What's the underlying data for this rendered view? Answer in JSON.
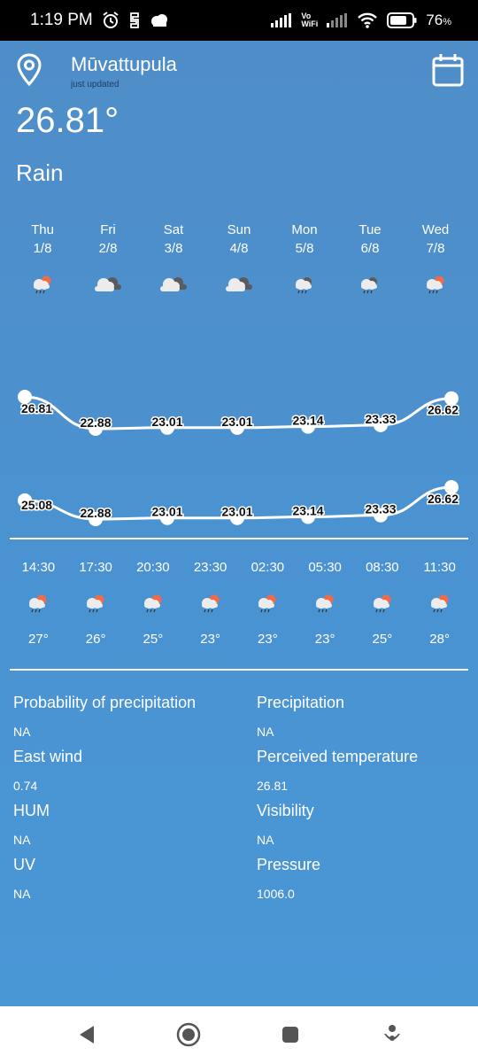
{
  "status": {
    "time": "1:19 PM",
    "battery": "76",
    "wifi_label_top": "Vo",
    "wifi_label_bottom": "WiFi"
  },
  "header": {
    "city": "Mūvattupula",
    "updated": "just updated",
    "temperature": "26.81°",
    "condition": "Rain"
  },
  "days": [
    {
      "name": "Thu",
      "date": "1/8",
      "icon": "rain-icon"
    },
    {
      "name": "Fri",
      "date": "2/8",
      "icon": "cloudy-icon"
    },
    {
      "name": "Sat",
      "date": "3/8",
      "icon": "cloudy-icon"
    },
    {
      "name": "Sun",
      "date": "4/8",
      "icon": "cloudy-icon"
    },
    {
      "name": "Mon",
      "date": "5/8",
      "icon": "cloud-rain-icon"
    },
    {
      "name": "Tue",
      "date": "6/8",
      "icon": "cloud-rain-icon"
    },
    {
      "name": "Wed",
      "date": "7/8",
      "icon": "rain-icon"
    }
  ],
  "chart_data": {
    "type": "line",
    "categories": [
      "Thu",
      "Fri",
      "Sat",
      "Sun",
      "Mon",
      "Tue",
      "Wed"
    ],
    "series": [
      {
        "values": [
          26.81,
          22.88,
          23.01,
          23.01,
          23.14,
          23.33,
          26.62
        ]
      },
      {
        "values": [
          25.08,
          22.88,
          23.01,
          23.01,
          23.14,
          23.33,
          26.62
        ]
      }
    ]
  },
  "hours": [
    {
      "time": "14:30",
      "temp": "27°"
    },
    {
      "time": "17:30",
      "temp": "26°"
    },
    {
      "time": "20:30",
      "temp": "25°"
    },
    {
      "time": "23:30",
      "temp": "23°"
    },
    {
      "time": "02:30",
      "temp": "23°"
    },
    {
      "time": "05:30",
      "temp": "23°"
    },
    {
      "time": "08:30",
      "temp": "25°"
    },
    {
      "time": "11:30",
      "temp": "28°"
    }
  ],
  "details": {
    "rows": [
      {
        "left_label": "Probability of precipitation",
        "left_value": "NA",
        "right_label": "Precipitation",
        "right_value": "NA"
      },
      {
        "left_label": "East wind",
        "left_value": "0.74",
        "right_label": "Perceived temperature",
        "right_value": "26.81"
      },
      {
        "left_label": "HUM",
        "left_value": "NA",
        "right_label": "Visibility",
        "right_value": "NA"
      },
      {
        "left_label": "UV",
        "left_value": "NA",
        "right_label": "Pressure",
        "right_value": "1006.0"
      }
    ]
  },
  "colors": {
    "background": "#4a90cf",
    "sun": "#ef6c4a",
    "cloud": "#ececec",
    "dark_cloud": "#5b5b5b"
  }
}
